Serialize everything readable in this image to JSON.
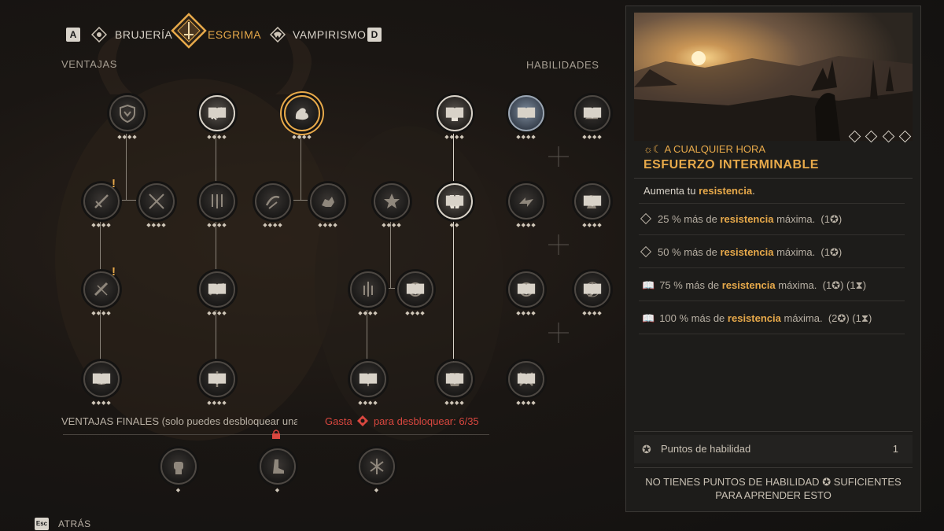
{
  "tabs": {
    "prev_key": "A",
    "next_key": "D",
    "items": [
      {
        "label": "BRUJERÍA",
        "active": false
      },
      {
        "label": "ESGRIMA",
        "active": true
      },
      {
        "label": "VAMPIRISMO",
        "active": false
      }
    ]
  },
  "sections": {
    "advantages": "VENTAJAS",
    "skills": "HABILIDADES",
    "final_advantages": "VENTAJAS FINALES (solo puedes desbloquear una",
    "unlock_prefix": "Gasta",
    "unlock_suffix": "para desbloquear: 6/35"
  },
  "detail": {
    "time_tag": "A CUALQUIER HORA",
    "title": "ESFUERZO INTERMINABLE",
    "desc_prefix": "Aumenta tu",
    "desc_highlight": "resistencia",
    "desc_suffix": ".",
    "image_pips": 4,
    "ranks": [
      {
        "icon": "diamond-icon",
        "pct": "25 % más de",
        "hl": "resistencia",
        "rest": "máxima.",
        "cost": "(1",
        "cost_close": ")",
        "time": ""
      },
      {
        "icon": "diamond-icon",
        "pct": "50 % más de",
        "hl": "resistencia",
        "rest": "máxima.",
        "cost": "(1",
        "cost_close": ")",
        "time": ""
      },
      {
        "icon": "book-icon",
        "pct": "75 % más de",
        "hl": "resistencia",
        "rest": "máxima.",
        "cost": "(1",
        "cost_close": ")",
        "time": "(1"
      },
      {
        "icon": "book-icon",
        "pct": "100 % más de",
        "hl": "resistencia",
        "rest": "máxima.",
        "cost": "(2",
        "cost_close": ")",
        "time": "(1"
      }
    ],
    "points_label": "Puntos de habilidad",
    "points_value": "1",
    "warning_line1_a": "NO TIENES PUNTOS DE HABILIDAD",
    "warning_line1_b": "SUFICIENTES",
    "warning_line2": "PARA APRENDER ESTO"
  },
  "footer": {
    "back_key": "Esc",
    "back_label": "ATRÁS"
  },
  "colors": {
    "accent": "#e7a94a",
    "unlock_text": "#d9473f",
    "text": "#cfc6b8"
  }
}
